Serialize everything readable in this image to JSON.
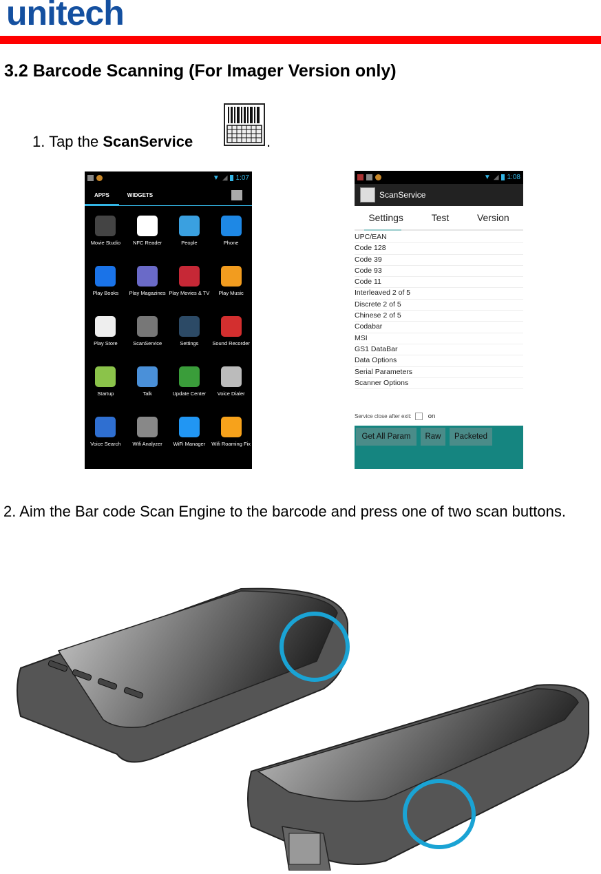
{
  "header": {
    "logo_text": "unitech",
    "brand_colors": {
      "logo": "#1450a0",
      "bar": "#ff0000"
    }
  },
  "section": {
    "title": "3.2 Barcode Scanning (For Imager Version only)"
  },
  "step1": {
    "prefix": "1. Tap the ",
    "app_name": "ScanService",
    "suffix": ".",
    "icon": "barcode-keypad-icon"
  },
  "phone_apps": {
    "status_time": "1:07",
    "tabs": [
      "APPS",
      "WIDGETS"
    ],
    "selected_tab": "APPS",
    "accent": "#33b5e5",
    "apps": [
      {
        "label": "Movie Studio",
        "icon": "clapperboard-icon",
        "color": "#444"
      },
      {
        "label": "NFC Reader",
        "icon": "nfc-icon",
        "color": "#fff"
      },
      {
        "label": "People",
        "icon": "contacts-icon",
        "color": "#3aa0e0"
      },
      {
        "label": "Phone",
        "icon": "phone-icon",
        "color": "#1e88e5"
      },
      {
        "label": "Play Books",
        "icon": "book-icon",
        "color": "#1a73e8"
      },
      {
        "label": "Play Magazines",
        "icon": "magazine-icon",
        "color": "#6a6ac8"
      },
      {
        "label": "Play Movies & TV",
        "icon": "film-icon",
        "color": "#c62836"
      },
      {
        "label": "Play Music",
        "icon": "headphones-icon",
        "color": "#f29c1f"
      },
      {
        "label": "Play Store",
        "icon": "store-bag-icon",
        "color": "#eee"
      },
      {
        "label": "ScanService",
        "icon": "barcode-keypad-icon",
        "color": "#777"
      },
      {
        "label": "Settings",
        "icon": "sliders-icon",
        "color": "#2c4a66"
      },
      {
        "label": "Sound Recorder",
        "icon": "microphone-icon",
        "color": "#d32f2f"
      },
      {
        "label": "Startup",
        "icon": "android-icon",
        "color": "#8bc34a"
      },
      {
        "label": "Talk",
        "icon": "talk-bubble-icon",
        "color": "#4a90d9"
      },
      {
        "label": "Update Center",
        "icon": "gear-refresh-icon",
        "color": "#3a9d3a"
      },
      {
        "label": "Voice Dialer",
        "icon": "speaker-icon",
        "color": "#bbb"
      },
      {
        "label": "Voice Search",
        "icon": "microphone-icon",
        "color": "#2f6fd1"
      },
      {
        "label": "Wifi Analyzer",
        "icon": "wifi-meter-icon",
        "color": "#888"
      },
      {
        "label": "WiFi Manager",
        "icon": "antenna-icon",
        "color": "#2196f3"
      },
      {
        "label": "Wifi Roaming Fix",
        "icon": "roaming-icon",
        "color": "#f7a21b"
      }
    ]
  },
  "phone_scan": {
    "status_time": "1:08",
    "app_title": "ScanService",
    "tabs": [
      "Settings",
      "Test",
      "Version"
    ],
    "selected_tab": "Settings",
    "items": [
      "UPC/EAN",
      "Code 128",
      "Code 39",
      "Code 93",
      "Code 11",
      "Interleaved 2 of 5",
      "Discrete 2 of 5",
      "Chinese 2 of 5",
      "Codabar",
      "MSI",
      "GS1 DataBar",
      "Data Options",
      "Serial Parameters",
      "Scanner Options"
    ],
    "service_close_label": "Service close after exit:",
    "service_close_checked": false,
    "service_close_on_label": "on",
    "buttons": [
      "Get All Param",
      "Raw",
      "Packeted"
    ],
    "footer_color": "#158580"
  },
  "step2": {
    "text": "2. Aim the Bar code Scan Engine to the barcode and press one of two scan buttons."
  },
  "illustration": {
    "description": "Two views of handheld device with scan buttons circled",
    "highlight_color": "#1aa3d4"
  }
}
